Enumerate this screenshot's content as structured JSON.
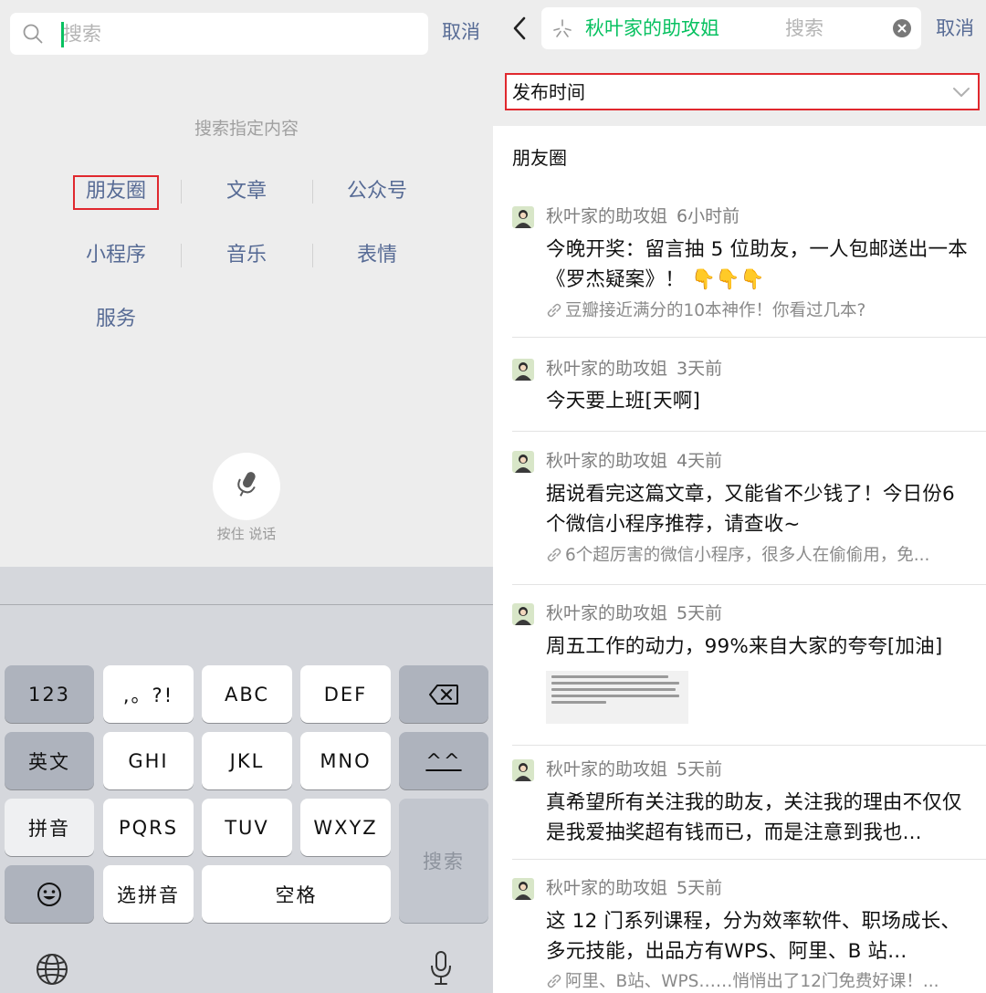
{
  "left": {
    "search_placeholder": "搜索",
    "cancel": "取消",
    "hint": "搜索指定内容",
    "categories": [
      "朋友圈",
      "文章",
      "公众号",
      "小程序",
      "音乐",
      "表情",
      "服务"
    ],
    "voice_label": "按住 说话",
    "keyboard": {
      "k123": "123",
      "punct": ",。?!",
      "abc": "ABC",
      "def": "DEF",
      "english": "英文",
      "ghi": "GHI",
      "jkl": "JKL",
      "mno": "MNO",
      "face_text": "^^",
      "pinyin": "拼音",
      "pqrs": "PQRS",
      "tuv": "TUV",
      "wxyz": "WXYZ",
      "search": "搜索",
      "select_pinyin": "选拼音",
      "space": "空格"
    }
  },
  "right": {
    "search_keyword": "秋叶家的助攻姐",
    "search_placeholder": "搜索",
    "cancel": "取消",
    "filter_label": "发布时间",
    "section_title": "朋友圈",
    "posts": [
      {
        "author": "秋叶家的助攻姐",
        "time": "6小时前",
        "text": "今晚开奖：留言抽 5 位助友，一人包邮送出一本《罗杰疑案》！",
        "emoji": "👇👇👇",
        "link": "豆瓣接近满分的10本神作！你看过几本?"
      },
      {
        "author": "秋叶家的助攻姐",
        "time": "3天前",
        "text": "今天要上班[天啊]"
      },
      {
        "author": "秋叶家的助攻姐",
        "time": "4天前",
        "text": "据说看完这篇文章，又能省不少钱了！今日份6个微信小程序推荐，请查收~",
        "link": "6个超厉害的微信小程序，很多人在偷偷用，免..."
      },
      {
        "author": "秋叶家的助攻姐",
        "time": "5天前",
        "text": "周五工作的动力，99%来自大家的夸夸[加油]"
      },
      {
        "author": "秋叶家的助攻姐",
        "time": "5天前",
        "text": "真希望所有关注我的助友，关注我的理由不仅仅是我爱抽奖超有钱而已，而是注意到我也..."
      },
      {
        "author": "秋叶家的助攻姐",
        "time": "5天前",
        "text": "这 12 门系列课程，分为效率软件、职场成长、多元技能，出品方有WPS、阿里、B 站...",
        "link": "阿里、B站、WPS……悄悄出了12门免费好课！..."
      }
    ]
  },
  "colors": {
    "link_blue": "#576b95",
    "wechat_green": "#07c160",
    "highlight_red": "#e0282e",
    "page_gray": "#ededed"
  }
}
